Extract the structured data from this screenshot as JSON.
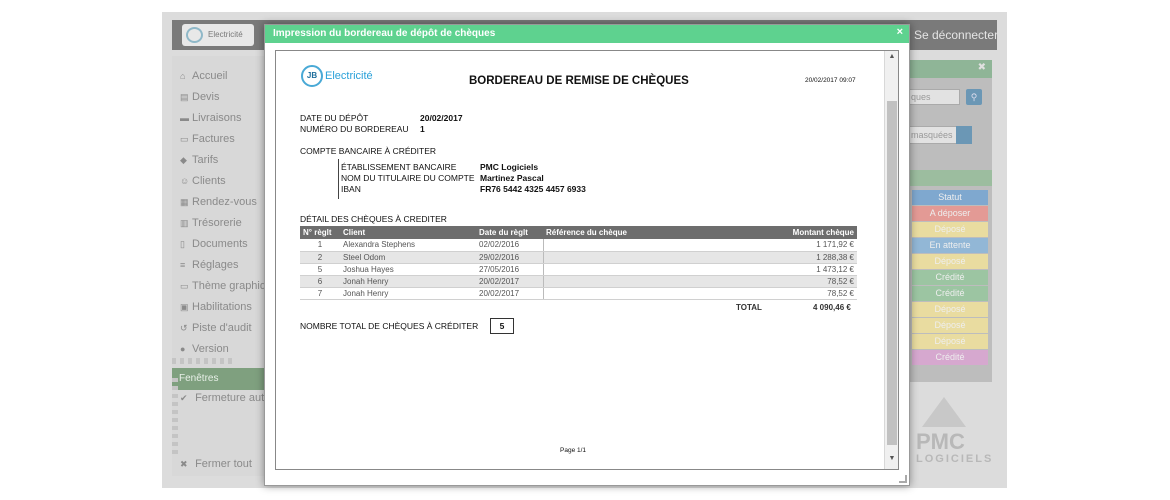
{
  "app": {
    "logo_text": "Electricité",
    "disconnect": "Se déconnecter",
    "sidebar": [
      {
        "icon": "home-icon",
        "glyph": "⌂",
        "label": "Accueil"
      },
      {
        "icon": "quote-icon",
        "glyph": "▤",
        "label": "Devis"
      },
      {
        "icon": "truck-icon",
        "glyph": "▬",
        "label": "Livraisons"
      },
      {
        "icon": "invoice-icon",
        "glyph": "▭",
        "label": "Factures"
      },
      {
        "icon": "tag-icon",
        "glyph": "◆",
        "label": "Tarifs"
      },
      {
        "icon": "user-icon",
        "glyph": "☺",
        "label": "Clients"
      },
      {
        "icon": "calendar-icon",
        "glyph": "▦",
        "label": "Rendez-vous"
      },
      {
        "icon": "bank-icon",
        "glyph": "▥",
        "label": "Trésorerie"
      },
      {
        "icon": "document-icon",
        "glyph": "▯",
        "label": "Documents"
      },
      {
        "icon": "sliders-icon",
        "glyph": "≡",
        "label": "Réglages"
      },
      {
        "icon": "monitor-icon",
        "glyph": "▭",
        "label": "Thème graphique"
      },
      {
        "icon": "lock-icon",
        "glyph": "▣",
        "label": "Habilitations"
      },
      {
        "icon": "history-icon",
        "glyph": "↺",
        "label": "Piste d'audit"
      },
      {
        "icon": "info-icon",
        "glyph": "●",
        "label": "Version"
      }
    ],
    "windows_header": "Fenêtres",
    "auto_close": "Fermeture auto.",
    "close_all": "Fermer tout",
    "right_panel": {
      "search_placeholder": "ques",
      "masked_select": "masquées",
      "status_header": "Statut",
      "statuses": [
        {
          "label": "A déposer",
          "color": "#e39a95"
        },
        {
          "label": "Déposé",
          "color": "#e9dca0"
        },
        {
          "label": "En attente",
          "color": "#92b7d6"
        },
        {
          "label": "Déposé",
          "color": "#e9dca0"
        },
        {
          "label": "Crédité",
          "color": "#9cc5a2"
        },
        {
          "label": "Crédité",
          "color": "#9cc5a2"
        },
        {
          "label": "Déposé",
          "color": "#e9dca0"
        },
        {
          "label": "Déposé",
          "color": "#e9dca0"
        },
        {
          "label": "Déposé",
          "color": "#e9dca0"
        },
        {
          "label": "Crédité",
          "color": "#d6a8cf"
        }
      ],
      "logo_line1": "PMC",
      "logo_line2": "LOGICIELS"
    }
  },
  "modal": {
    "title": "Impression du bordereau de dépôt de chèques",
    "document": {
      "brand_initials": "JB",
      "brand_name": "Electricité",
      "title": "BORDEREAU DE REMISE DE CHÈQUES",
      "printed_at": "20/02/2017 09:07",
      "deposit_date_label": "DATE DU DÉPÔT",
      "deposit_date": "20/02/2017",
      "slip_number_label": "NUMÉRO DU BORDEREAU",
      "slip_number": "1",
      "account_label": "COMPTE BANCAIRE À CRÉDITER",
      "bank_label": "ÉTABLISSEMENT BANCAIRE",
      "bank": "PMC Logiciels",
      "holder_label": "NOM DU TITULAIRE DU COMPTE",
      "holder": "Martinez Pascal",
      "iban_label": "IBAN",
      "iban": "FR76 5442 4325 4457 6933",
      "detail_label": "DÉTAIL DES CHÈQUES À CREDITER",
      "columns": [
        "N° règlt",
        "Client",
        "Date du règlt",
        "Référence du chèque",
        "Montant chèque"
      ],
      "rows": [
        {
          "n": "1",
          "client": "Alexandra Stephens",
          "date": "02/02/2016",
          "ref": "",
          "amount": "1 171,92 €"
        },
        {
          "n": "2",
          "client": "Steel Odom",
          "date": "29/02/2016",
          "ref": "",
          "amount": "1 288,38 €"
        },
        {
          "n": "5",
          "client": "Joshua Hayes",
          "date": "27/05/2016",
          "ref": "",
          "amount": "1 473,12 €"
        },
        {
          "n": "6",
          "client": "Jonah Henry",
          "date": "20/02/2017",
          "ref": "",
          "amount": "78,52 €"
        },
        {
          "n": "7",
          "client": "Jonah Henry",
          "date": "20/02/2017",
          "ref": "",
          "amount": "78,52 €"
        }
      ],
      "total_label": "TOTAL",
      "total": "4 090,46 €",
      "count_label": "NOMBRE TOTAL DE CHÈQUES À CRÉDITER",
      "count": "5",
      "page": "Page 1/1"
    }
  }
}
